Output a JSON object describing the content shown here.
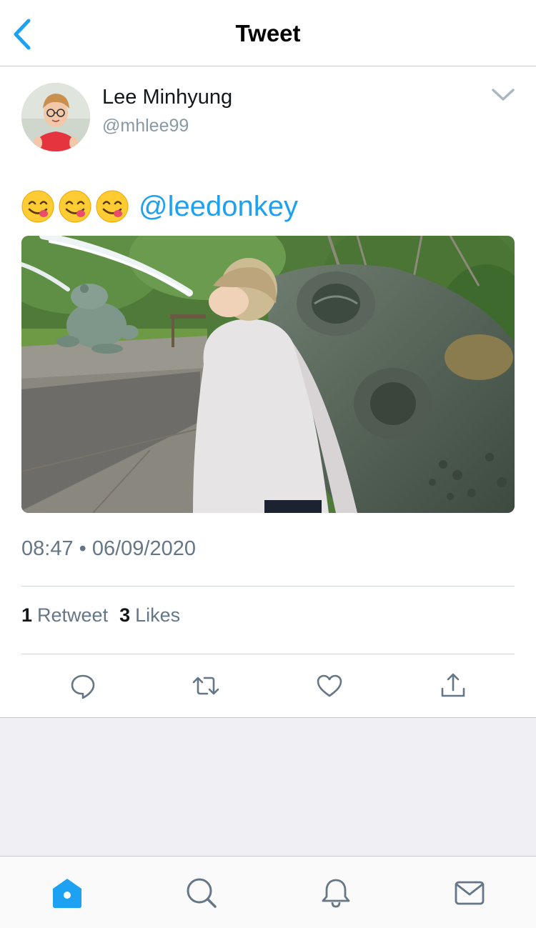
{
  "header": {
    "title": "Tweet",
    "back_icon": "chevron-left-icon"
  },
  "colors": {
    "accent": "#1da1f2",
    "secondary_text": "#657786",
    "handle_text": "#8899a6",
    "divider": "#ccd6dd",
    "background_gray": "#efeff4"
  },
  "tweet": {
    "author": {
      "display_name": "Lee Minhyung",
      "handle": "@mhlee99"
    },
    "text": {
      "emojis": [
        "😋",
        "😋",
        "😋"
      ],
      "mention": "@leedonkey"
    },
    "timestamp": "08:47 • 06/09/2020",
    "stats": {
      "retweets_count": "1",
      "retweets_label": "Retweet",
      "likes_count": "3",
      "likes_label": "Likes"
    },
    "actions": [
      "reply-icon",
      "retweet-icon",
      "like-icon",
      "share-icon"
    ]
  },
  "tabbar": {
    "items": [
      "home-icon",
      "search-icon",
      "notifications-icon",
      "messages-icon"
    ],
    "active": "home-icon"
  }
}
